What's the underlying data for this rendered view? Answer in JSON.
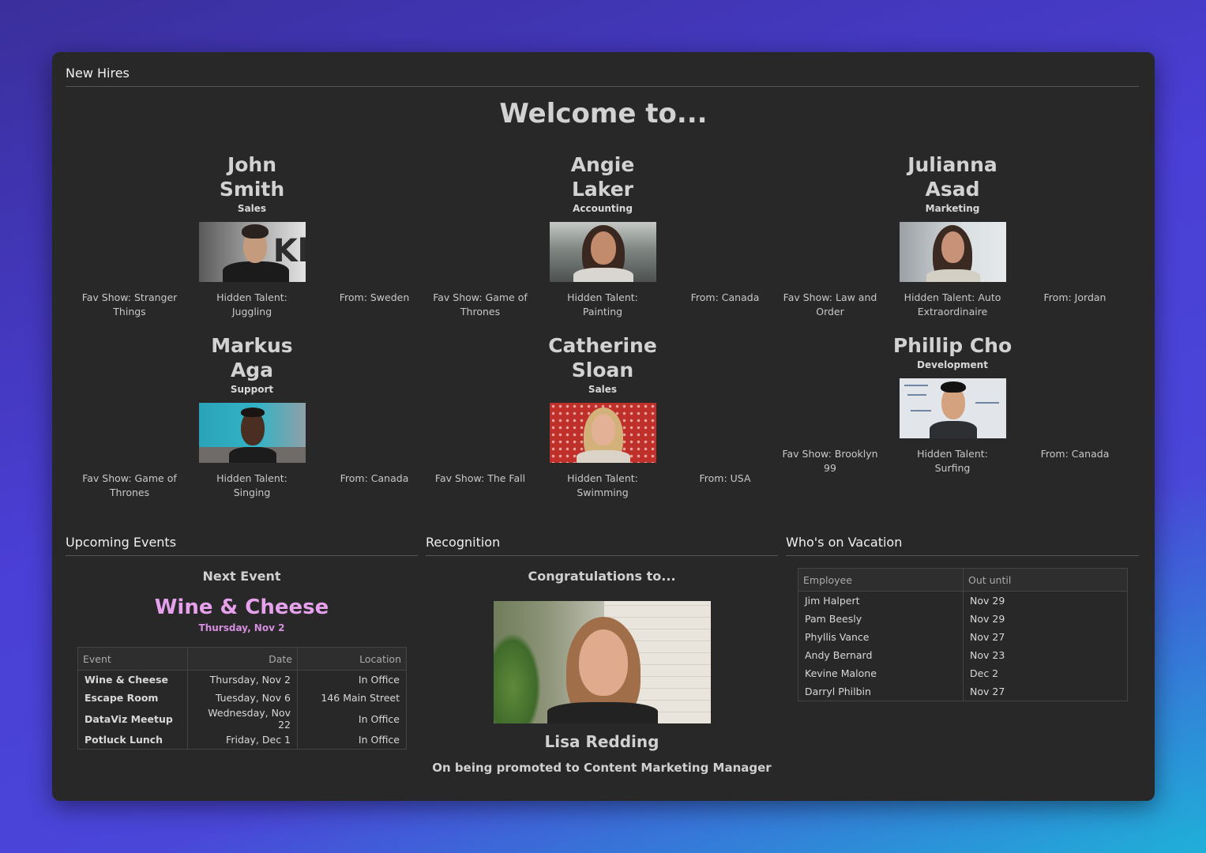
{
  "header": {
    "title": "New Hires"
  },
  "welcome": "Welcome to...",
  "hires": [
    {
      "name": "John Smith",
      "dept": "Sales",
      "fav": "Fav Show: Stranger Things",
      "talent": "Hidden Talent: Juggling",
      "from": "From: Sweden"
    },
    {
      "name": "Angie Laker",
      "dept": "Accounting",
      "fav": "Fav Show: Game of Thrones",
      "talent": "Hidden Talent: Painting",
      "from": "From: Canada"
    },
    {
      "name": "Julianna Asad",
      "dept": "Marketing",
      "fav": "Fav Show: Law and Order",
      "talent": "Hidden Talent: Auto Extraordinaire",
      "from": "From: Jordan"
    },
    {
      "name": "Markus Aga",
      "dept": "Support",
      "fav": "Fav Show: Game of Thrones",
      "talent": "Hidden Talent: Singing",
      "from": "From: Canada"
    },
    {
      "name": "Catherine Sloan",
      "dept": "Sales",
      "fav": "Fav Show: The Fall",
      "talent": "Hidden Talent: Swimming",
      "from": "From: USA"
    },
    {
      "name": "Phillip Cho",
      "dept": "Development",
      "fav": "Fav Show: Brooklyn 99",
      "talent": "Hidden Talent: Surfing",
      "from": "From: Canada"
    }
  ],
  "events": {
    "title": "Upcoming Events",
    "next_label": "Next Event",
    "next_name": "Wine & Cheese",
    "next_date": "Thursday, Nov 2",
    "columns": [
      "Event",
      "Date",
      "Location"
    ],
    "rows": [
      [
        "Wine & Cheese",
        "Thursday, Nov 2",
        "In Office"
      ],
      [
        "Escape Room",
        "Tuesday, Nov 6",
        "146 Main Street"
      ],
      [
        "DataViz Meetup",
        "Wednesday, Nov 22",
        "In Office"
      ],
      [
        "Potluck Lunch",
        "Friday, Dec 1",
        "In Office"
      ]
    ]
  },
  "recognition": {
    "title": "Recognition",
    "congrats": "Congratulations to...",
    "name": "Lisa Redding",
    "reason": "On being promoted to Content Marketing Manager"
  },
  "vacation": {
    "title": "Who's on Vacation",
    "columns": [
      "Employee",
      "Out until"
    ],
    "rows": [
      [
        "Jim Halpert",
        "Nov 29"
      ],
      [
        "Pam Beesly",
        "Nov 29"
      ],
      [
        "Phyllis Vance",
        "Nov 27"
      ],
      [
        "Andy Bernard",
        "Nov 23"
      ],
      [
        "Kevine Malone",
        "Dec 2"
      ],
      [
        "Darryl Philbin",
        "Nov 27"
      ]
    ]
  },
  "colors": {
    "accent": "#e7a0ec",
    "panel": "#282828"
  }
}
